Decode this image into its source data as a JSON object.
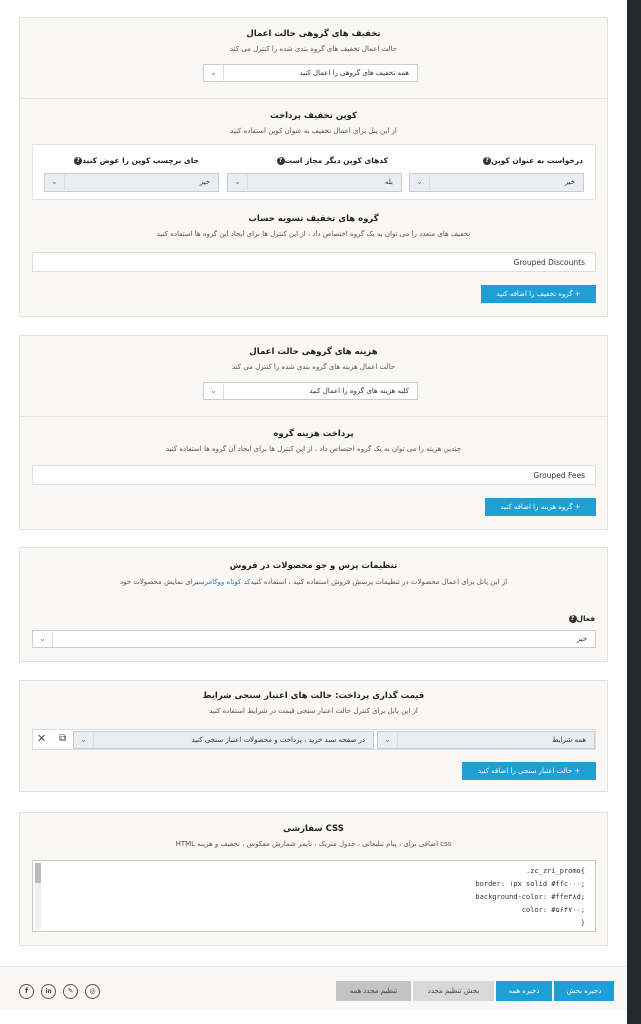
{
  "colors": {
    "accent": "#1e9fd6",
    "panel_bg": "#f9f8f4",
    "select_bg": "#e9eef4"
  },
  "discounts_panel": {
    "group_mode_title": "تخفیف های گروهی حالت اعمال",
    "group_mode_desc": "حالت اعمال تخفیف های گروه بندی شده را کنترل می کند",
    "group_mode_value": "همه تخفیف های گروهی را اعمال کنید",
    "coupon_title": "کوپن تخفیف پرداخت",
    "coupon_desc": "از این پنل برای اعمال تخفیف به عنوان کوپن استفاده کنید",
    "coupon_fields": [
      {
        "label": "درخواست به عنوان کوپن",
        "value": "خیر"
      },
      {
        "label": "کدهای کوپن دیگر مجاز است",
        "value": "بله"
      },
      {
        "label": "جای برچسب کوپن را عوض کنید",
        "value": "خیر"
      }
    ],
    "settle_title": "گروه های تخفیف تسویه حساب",
    "settle_desc": "تخفیف های متعدد را می توان به یک گروه اختصاص داد ، از این کنترل ها برای ایجاد این گروه ها استفاده کنید",
    "group_name": "Grouped Discounts",
    "add_button": "+ گروه تخفیف را اضافه کنید"
  },
  "fees_panel": {
    "group_mode_title": "هزینه های گروهی حالت اعمال",
    "group_mode_desc": "حالت اعمال هزینه های گروه بندی شده را کنترل می کند",
    "group_mode_value": "کلیه هزینه های گروه را اعمال کنید",
    "payment_title": "پرداخت هزینه گروه",
    "payment_desc": "چندین هزینه را می توان به یک گروه اختصاص داد ، از این کنترل ها برای ایجاد آن گروه ها استفاده کنید",
    "group_name": "Grouped Fees",
    "add_button": "+ گروه هزینه را اضافه کنید"
  },
  "search_panel": {
    "title": "تنظیمات پرس و جو محصولات در فروش",
    "desc_before": "از این پانل برای اعمال محصولات در تنظیمات پرسش فروش استفاده کنید ، استفاده کنید",
    "desc_link": "کد کوتاه ووکامرس",
    "desc_after": "برای نمایش محصولات خود",
    "active_label": "فعال",
    "active_value": "خیر"
  },
  "conditions_panel": {
    "title": "قیمت گذاری پرداخت: حالت های اعتبار سنجی شرایط",
    "desc": "از این پانل برای کنترل حالت اعتبار سنجی قیمت در شرایط استفاده کنید",
    "condition_value": "همه شرایط",
    "context_value": "در صفحه سبد خرید ، پرداخت و محصولات اعتبار سنجی کنید",
    "add_button": "+ حالت اعتبار سنجی را اضافه کنید"
  },
  "css_panel": {
    "title": "CSS سفارشی",
    "desc": "css اضافی برای ، پیام تبلیغاتی ، جدول متریک ، تایمر شمارش معکوس ، تخفیف و هزینه HTML",
    "code_lines": [
      "}zc_zri_promo.",
      ";border: ۱px solid #ffc۰۰۰",
      ";background-color: #ffe۳۸d",
      ";color: #۵۶۴۷۰۰",
      "{"
    ]
  },
  "footer": {
    "save_section": "ذخیره بخش",
    "save_all": "ذخیره همه",
    "reset_section": "بخش تنظیم مجدد",
    "reset_all": "تنظیم مجدد همه",
    "social_icons": [
      "facebook-icon",
      "linkedin-icon",
      "brush-icon",
      "instagram-icon"
    ]
  }
}
